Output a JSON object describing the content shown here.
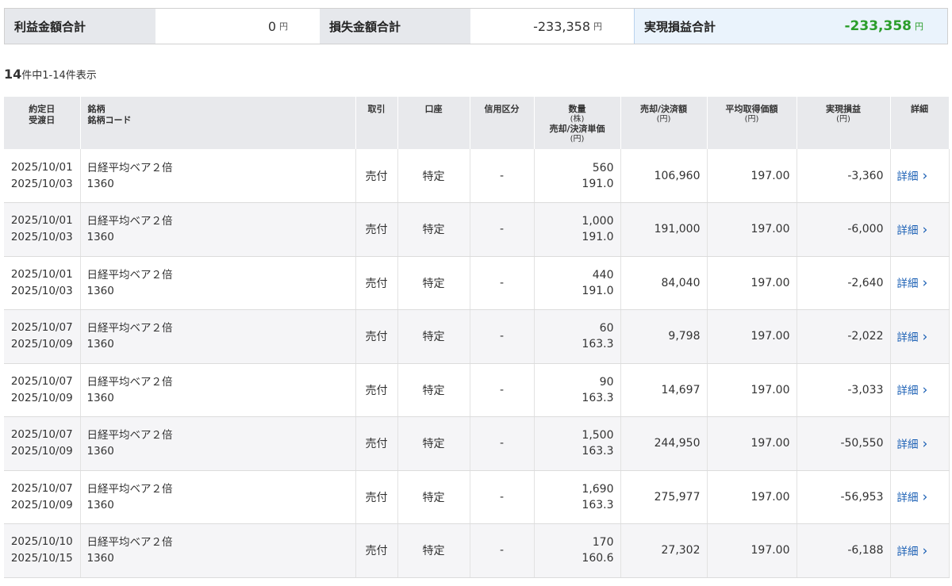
{
  "summary": {
    "profit_label": "利益金額合計",
    "profit_value": "0",
    "loss_label": "損失金額合計",
    "loss_value": "-233,358",
    "realized_label": "実現損益合計",
    "realized_value": "-233,358",
    "unit": "円"
  },
  "count": {
    "total": "14",
    "text": "件中1-14件表示"
  },
  "headers": {
    "trade_date": "約定日",
    "settle_date": "受渡日",
    "stock": "銘柄",
    "stock_code": "銘柄コード",
    "trade": "取引",
    "account": "口座",
    "margin": "信用区分",
    "quantity": "数量",
    "quantity_unit": "(株)",
    "unit_price": "売却/決済単価",
    "yen": "(円)",
    "amount": "売却/決済額",
    "avg_cost": "平均取得価額",
    "pnl": "実現損益",
    "detail": "詳細"
  },
  "rows": [
    {
      "trade_date": "2025/10/01",
      "settle_date": "2025/10/03",
      "name": "日経平均ベア２倍",
      "code": "1360",
      "trade": "売付",
      "account": "特定",
      "margin": "-",
      "qty": "560",
      "price": "191.0",
      "amount": "106,960",
      "avg": "197.00",
      "pnl": "-3,360",
      "detail": "詳細"
    },
    {
      "trade_date": "2025/10/01",
      "settle_date": "2025/10/03",
      "name": "日経平均ベア２倍",
      "code": "1360",
      "trade": "売付",
      "account": "特定",
      "margin": "-",
      "qty": "1,000",
      "price": "191.0",
      "amount": "191,000",
      "avg": "197.00",
      "pnl": "-6,000",
      "detail": "詳細"
    },
    {
      "trade_date": "2025/10/01",
      "settle_date": "2025/10/03",
      "name": "日経平均ベア２倍",
      "code": "1360",
      "trade": "売付",
      "account": "特定",
      "margin": "-",
      "qty": "440",
      "price": "191.0",
      "amount": "84,040",
      "avg": "197.00",
      "pnl": "-2,640",
      "detail": "詳細"
    },
    {
      "trade_date": "2025/10/07",
      "settle_date": "2025/10/09",
      "name": "日経平均ベア２倍",
      "code": "1360",
      "trade": "売付",
      "account": "特定",
      "margin": "-",
      "qty": "60",
      "price": "163.3",
      "amount": "9,798",
      "avg": "197.00",
      "pnl": "-2,022",
      "detail": "詳細"
    },
    {
      "trade_date": "2025/10/07",
      "settle_date": "2025/10/09",
      "name": "日経平均ベア２倍",
      "code": "1360",
      "trade": "売付",
      "account": "特定",
      "margin": "-",
      "qty": "90",
      "price": "163.3",
      "amount": "14,697",
      "avg": "197.00",
      "pnl": "-3,033",
      "detail": "詳細"
    },
    {
      "trade_date": "2025/10/07",
      "settle_date": "2025/10/09",
      "name": "日経平均ベア２倍",
      "code": "1360",
      "trade": "売付",
      "account": "特定",
      "margin": "-",
      "qty": "1,500",
      "price": "163.3",
      "amount": "244,950",
      "avg": "197.00",
      "pnl": "-50,550",
      "detail": "詳細"
    },
    {
      "trade_date": "2025/10/07",
      "settle_date": "2025/10/09",
      "name": "日経平均ベア２倍",
      "code": "1360",
      "trade": "売付",
      "account": "特定",
      "margin": "-",
      "qty": "1,690",
      "price": "163.3",
      "amount": "275,977",
      "avg": "197.00",
      "pnl": "-56,953",
      "detail": "詳細"
    },
    {
      "trade_date": "2025/10/10",
      "settle_date": "2025/10/15",
      "name": "日経平均ベア２倍",
      "code": "1360",
      "trade": "売付",
      "account": "特定",
      "margin": "-",
      "qty": "170",
      "price": "160.6",
      "amount": "27,302",
      "avg": "197.00",
      "pnl": "-6,188",
      "detail": "詳細"
    }
  ],
  "colors": {
    "pnl_negative": "#2a9d2a",
    "link": "#1a5fb4",
    "header_bg": "#e8e9ec"
  }
}
